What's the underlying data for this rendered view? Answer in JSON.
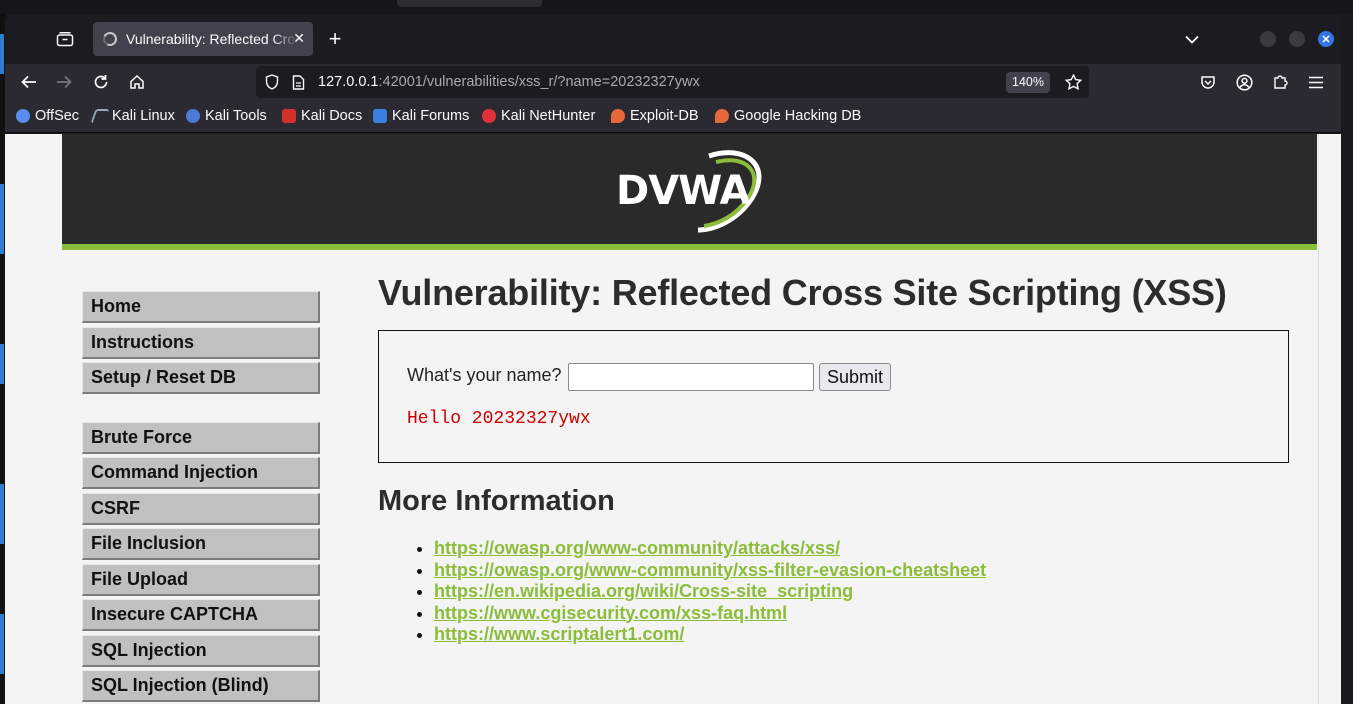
{
  "browser": {
    "tab": {
      "title": "Vulnerability: Reflected Cross Site Scripting (XSS)"
    },
    "url": {
      "host": "127.0.0.1",
      "rest": ":42001/vulnerabilities/xss_r/?name=20232327ywx"
    },
    "zoom": "140%",
    "bookmarks": [
      {
        "label": "OffSec",
        "icon": "offsec-icon",
        "color": "#5a8dee"
      },
      {
        "label": "Kali Linux",
        "icon": "kali-dragon-icon",
        "color": "#9ab"
      },
      {
        "label": "Kali Tools",
        "icon": "kali-tools-icon",
        "color": "#4b7bd6"
      },
      {
        "label": "Kali Docs",
        "icon": "kali-docs-icon",
        "color": "#d3312d"
      },
      {
        "label": "Kali Forums",
        "icon": "kali-forums-icon",
        "color": "#3d7fe0"
      },
      {
        "label": "Kali NetHunter",
        "icon": "nethunter-icon",
        "color": "#e0303a"
      },
      {
        "label": "Exploit-DB",
        "icon": "exploit-db-icon",
        "color": "#e4683a"
      },
      {
        "label": "Google Hacking DB",
        "icon": "ghdb-icon",
        "color": "#e4683a"
      }
    ]
  },
  "dvwa": {
    "logo_text": "DVWA",
    "menu": {
      "group1": [
        "Home",
        "Instructions",
        "Setup / Reset DB"
      ],
      "group2": [
        "Brute Force",
        "Command Injection",
        "CSRF",
        "File Inclusion",
        "File Upload",
        "Insecure CAPTCHA",
        "SQL Injection",
        "SQL Injection (Blind)"
      ]
    },
    "title": "Vulnerability: Reflected Cross Site Scripting (XSS)",
    "form": {
      "label": "What's your name?",
      "input_value": "",
      "submit_label": "Submit"
    },
    "output": "Hello 20232327ywx",
    "more_info_title": "More Information",
    "links": [
      "https://owasp.org/www-community/attacks/xss/",
      "https://owasp.org/www-community/xss-filter-evasion-cheatsheet",
      "https://en.wikipedia.org/wiki/Cross-site_scripting",
      "https://www.cgisecurity.com/xss-faq.html",
      "https://www.scriptalert1.com/"
    ],
    "colors": {
      "accent": "#8bbd3a",
      "header_bg": "#2a2a2a",
      "output_red": "#cc0000"
    }
  }
}
